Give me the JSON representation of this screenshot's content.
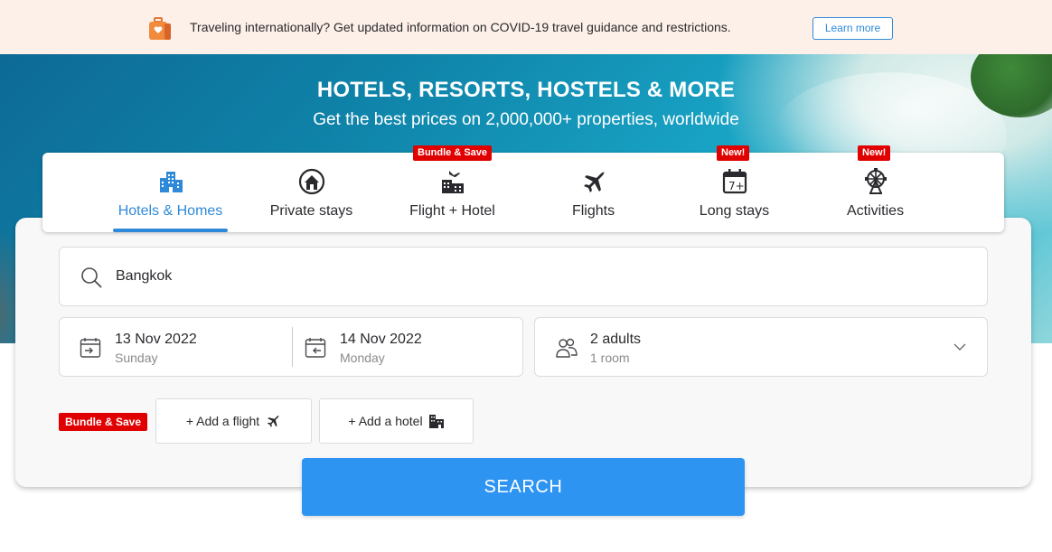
{
  "notice": {
    "text": "Traveling internationally? Get updated information on COVID-19 travel guidance and restrictions.",
    "button": "Learn more",
    "icon": "luggage-heart-icon"
  },
  "hero": {
    "title": "HOTELS, RESORTS, HOSTELS & MORE",
    "subtitle": "Get the best prices on 2,000,000+ properties, worldwide"
  },
  "tabs": [
    {
      "label": "Hotels & Homes",
      "icon": "hotel-building-icon",
      "active": true,
      "badge": ""
    },
    {
      "label": "Private stays",
      "icon": "house-icon",
      "active": false,
      "badge": ""
    },
    {
      "label": "Flight + Hotel",
      "icon": "flight-hotel-icon",
      "active": false,
      "badge": "Bundle & Save"
    },
    {
      "label": "Flights",
      "icon": "airplane-icon",
      "active": false,
      "badge": ""
    },
    {
      "label": "Long stays",
      "icon": "calendar-7-icon",
      "active": false,
      "badge": "New!"
    },
    {
      "label": "Activities",
      "icon": "ferris-wheel-icon",
      "active": false,
      "badge": "New!"
    }
  ],
  "search": {
    "value": "Bangkok"
  },
  "checkin": {
    "date": "13 Nov 2022",
    "day": "Sunday"
  },
  "checkout": {
    "date": "14 Nov 2022",
    "day": "Monday"
  },
  "guests": {
    "main": "2 adults",
    "sub": "1 room"
  },
  "bundle": {
    "badge": "Bundle & Save",
    "add_flight": "+ Add a flight",
    "add_hotel": "+ Add a hotel"
  },
  "search_button": "SEARCH",
  "colors": {
    "accent": "#2e8ad8",
    "button": "#2e94f2",
    "badge": "#e00000",
    "notice_bg": "#fdf0e8"
  }
}
